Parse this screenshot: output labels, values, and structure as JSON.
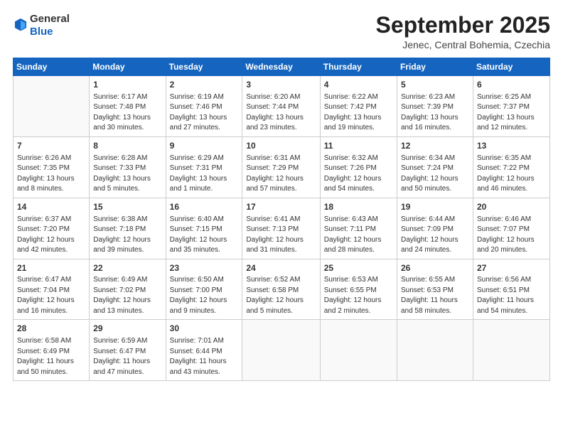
{
  "header": {
    "logo_line1": "General",
    "logo_line2": "Blue",
    "month_title": "September 2025",
    "location": "Jenec, Central Bohemia, Czechia"
  },
  "weekdays": [
    "Sunday",
    "Monday",
    "Tuesday",
    "Wednesday",
    "Thursday",
    "Friday",
    "Saturday"
  ],
  "weeks": [
    [
      {
        "day": "",
        "info": ""
      },
      {
        "day": "1",
        "info": "Sunrise: 6:17 AM\nSunset: 7:48 PM\nDaylight: 13 hours\nand 30 minutes."
      },
      {
        "day": "2",
        "info": "Sunrise: 6:19 AM\nSunset: 7:46 PM\nDaylight: 13 hours\nand 27 minutes."
      },
      {
        "day": "3",
        "info": "Sunrise: 6:20 AM\nSunset: 7:44 PM\nDaylight: 13 hours\nand 23 minutes."
      },
      {
        "day": "4",
        "info": "Sunrise: 6:22 AM\nSunset: 7:42 PM\nDaylight: 13 hours\nand 19 minutes."
      },
      {
        "day": "5",
        "info": "Sunrise: 6:23 AM\nSunset: 7:39 PM\nDaylight: 13 hours\nand 16 minutes."
      },
      {
        "day": "6",
        "info": "Sunrise: 6:25 AM\nSunset: 7:37 PM\nDaylight: 13 hours\nand 12 minutes."
      }
    ],
    [
      {
        "day": "7",
        "info": "Sunrise: 6:26 AM\nSunset: 7:35 PM\nDaylight: 13 hours\nand 8 minutes."
      },
      {
        "day": "8",
        "info": "Sunrise: 6:28 AM\nSunset: 7:33 PM\nDaylight: 13 hours\nand 5 minutes."
      },
      {
        "day": "9",
        "info": "Sunrise: 6:29 AM\nSunset: 7:31 PM\nDaylight: 13 hours\nand 1 minute."
      },
      {
        "day": "10",
        "info": "Sunrise: 6:31 AM\nSunset: 7:29 PM\nDaylight: 12 hours\nand 57 minutes."
      },
      {
        "day": "11",
        "info": "Sunrise: 6:32 AM\nSunset: 7:26 PM\nDaylight: 12 hours\nand 54 minutes."
      },
      {
        "day": "12",
        "info": "Sunrise: 6:34 AM\nSunset: 7:24 PM\nDaylight: 12 hours\nand 50 minutes."
      },
      {
        "day": "13",
        "info": "Sunrise: 6:35 AM\nSunset: 7:22 PM\nDaylight: 12 hours\nand 46 minutes."
      }
    ],
    [
      {
        "day": "14",
        "info": "Sunrise: 6:37 AM\nSunset: 7:20 PM\nDaylight: 12 hours\nand 42 minutes."
      },
      {
        "day": "15",
        "info": "Sunrise: 6:38 AM\nSunset: 7:18 PM\nDaylight: 12 hours\nand 39 minutes."
      },
      {
        "day": "16",
        "info": "Sunrise: 6:40 AM\nSunset: 7:15 PM\nDaylight: 12 hours\nand 35 minutes."
      },
      {
        "day": "17",
        "info": "Sunrise: 6:41 AM\nSunset: 7:13 PM\nDaylight: 12 hours\nand 31 minutes."
      },
      {
        "day": "18",
        "info": "Sunrise: 6:43 AM\nSunset: 7:11 PM\nDaylight: 12 hours\nand 28 minutes."
      },
      {
        "day": "19",
        "info": "Sunrise: 6:44 AM\nSunset: 7:09 PM\nDaylight: 12 hours\nand 24 minutes."
      },
      {
        "day": "20",
        "info": "Sunrise: 6:46 AM\nSunset: 7:07 PM\nDaylight: 12 hours\nand 20 minutes."
      }
    ],
    [
      {
        "day": "21",
        "info": "Sunrise: 6:47 AM\nSunset: 7:04 PM\nDaylight: 12 hours\nand 16 minutes."
      },
      {
        "day": "22",
        "info": "Sunrise: 6:49 AM\nSunset: 7:02 PM\nDaylight: 12 hours\nand 13 minutes."
      },
      {
        "day": "23",
        "info": "Sunrise: 6:50 AM\nSunset: 7:00 PM\nDaylight: 12 hours\nand 9 minutes."
      },
      {
        "day": "24",
        "info": "Sunrise: 6:52 AM\nSunset: 6:58 PM\nDaylight: 12 hours\nand 5 minutes."
      },
      {
        "day": "25",
        "info": "Sunrise: 6:53 AM\nSunset: 6:55 PM\nDaylight: 12 hours\nand 2 minutes."
      },
      {
        "day": "26",
        "info": "Sunrise: 6:55 AM\nSunset: 6:53 PM\nDaylight: 11 hours\nand 58 minutes."
      },
      {
        "day": "27",
        "info": "Sunrise: 6:56 AM\nSunset: 6:51 PM\nDaylight: 11 hours\nand 54 minutes."
      }
    ],
    [
      {
        "day": "28",
        "info": "Sunrise: 6:58 AM\nSunset: 6:49 PM\nDaylight: 11 hours\nand 50 minutes."
      },
      {
        "day": "29",
        "info": "Sunrise: 6:59 AM\nSunset: 6:47 PM\nDaylight: 11 hours\nand 47 minutes."
      },
      {
        "day": "30",
        "info": "Sunrise: 7:01 AM\nSunset: 6:44 PM\nDaylight: 11 hours\nand 43 minutes."
      },
      {
        "day": "",
        "info": ""
      },
      {
        "day": "",
        "info": ""
      },
      {
        "day": "",
        "info": ""
      },
      {
        "day": "",
        "info": ""
      }
    ]
  ]
}
